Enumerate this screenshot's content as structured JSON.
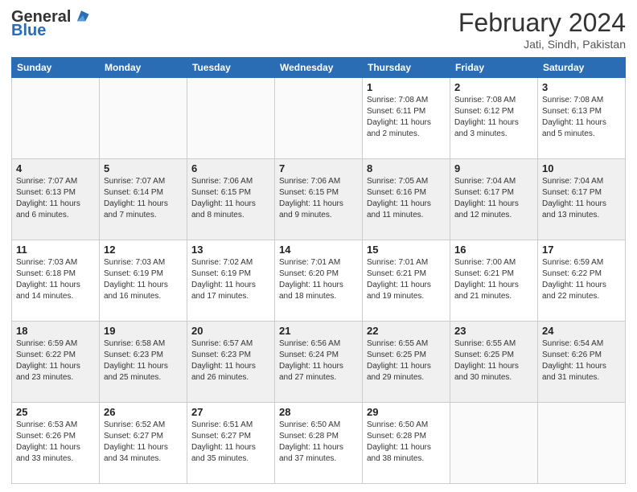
{
  "header": {
    "logo_general": "General",
    "logo_blue": "Blue",
    "month_title": "February 2024",
    "location": "Jati, Sindh, Pakistan"
  },
  "weekdays": [
    "Sunday",
    "Monday",
    "Tuesday",
    "Wednesday",
    "Thursday",
    "Friday",
    "Saturday"
  ],
  "weeks": [
    [
      {
        "day": "",
        "info": ""
      },
      {
        "day": "",
        "info": ""
      },
      {
        "day": "",
        "info": ""
      },
      {
        "day": "",
        "info": ""
      },
      {
        "day": "1",
        "info": "Sunrise: 7:08 AM\nSunset: 6:11 PM\nDaylight: 11 hours\nand 2 minutes."
      },
      {
        "day": "2",
        "info": "Sunrise: 7:08 AM\nSunset: 6:12 PM\nDaylight: 11 hours\nand 3 minutes."
      },
      {
        "day": "3",
        "info": "Sunrise: 7:08 AM\nSunset: 6:13 PM\nDaylight: 11 hours\nand 5 minutes."
      }
    ],
    [
      {
        "day": "4",
        "info": "Sunrise: 7:07 AM\nSunset: 6:13 PM\nDaylight: 11 hours\nand 6 minutes."
      },
      {
        "day": "5",
        "info": "Sunrise: 7:07 AM\nSunset: 6:14 PM\nDaylight: 11 hours\nand 7 minutes."
      },
      {
        "day": "6",
        "info": "Sunrise: 7:06 AM\nSunset: 6:15 PM\nDaylight: 11 hours\nand 8 minutes."
      },
      {
        "day": "7",
        "info": "Sunrise: 7:06 AM\nSunset: 6:15 PM\nDaylight: 11 hours\nand 9 minutes."
      },
      {
        "day": "8",
        "info": "Sunrise: 7:05 AM\nSunset: 6:16 PM\nDaylight: 11 hours\nand 11 minutes."
      },
      {
        "day": "9",
        "info": "Sunrise: 7:04 AM\nSunset: 6:17 PM\nDaylight: 11 hours\nand 12 minutes."
      },
      {
        "day": "10",
        "info": "Sunrise: 7:04 AM\nSunset: 6:17 PM\nDaylight: 11 hours\nand 13 minutes."
      }
    ],
    [
      {
        "day": "11",
        "info": "Sunrise: 7:03 AM\nSunset: 6:18 PM\nDaylight: 11 hours\nand 14 minutes."
      },
      {
        "day": "12",
        "info": "Sunrise: 7:03 AM\nSunset: 6:19 PM\nDaylight: 11 hours\nand 16 minutes."
      },
      {
        "day": "13",
        "info": "Sunrise: 7:02 AM\nSunset: 6:19 PM\nDaylight: 11 hours\nand 17 minutes."
      },
      {
        "day": "14",
        "info": "Sunrise: 7:01 AM\nSunset: 6:20 PM\nDaylight: 11 hours\nand 18 minutes."
      },
      {
        "day": "15",
        "info": "Sunrise: 7:01 AM\nSunset: 6:21 PM\nDaylight: 11 hours\nand 19 minutes."
      },
      {
        "day": "16",
        "info": "Sunrise: 7:00 AM\nSunset: 6:21 PM\nDaylight: 11 hours\nand 21 minutes."
      },
      {
        "day": "17",
        "info": "Sunrise: 6:59 AM\nSunset: 6:22 PM\nDaylight: 11 hours\nand 22 minutes."
      }
    ],
    [
      {
        "day": "18",
        "info": "Sunrise: 6:59 AM\nSunset: 6:22 PM\nDaylight: 11 hours\nand 23 minutes."
      },
      {
        "day": "19",
        "info": "Sunrise: 6:58 AM\nSunset: 6:23 PM\nDaylight: 11 hours\nand 25 minutes."
      },
      {
        "day": "20",
        "info": "Sunrise: 6:57 AM\nSunset: 6:23 PM\nDaylight: 11 hours\nand 26 minutes."
      },
      {
        "day": "21",
        "info": "Sunrise: 6:56 AM\nSunset: 6:24 PM\nDaylight: 11 hours\nand 27 minutes."
      },
      {
        "day": "22",
        "info": "Sunrise: 6:55 AM\nSunset: 6:25 PM\nDaylight: 11 hours\nand 29 minutes."
      },
      {
        "day": "23",
        "info": "Sunrise: 6:55 AM\nSunset: 6:25 PM\nDaylight: 11 hours\nand 30 minutes."
      },
      {
        "day": "24",
        "info": "Sunrise: 6:54 AM\nSunset: 6:26 PM\nDaylight: 11 hours\nand 31 minutes."
      }
    ],
    [
      {
        "day": "25",
        "info": "Sunrise: 6:53 AM\nSunset: 6:26 PM\nDaylight: 11 hours\nand 33 minutes."
      },
      {
        "day": "26",
        "info": "Sunrise: 6:52 AM\nSunset: 6:27 PM\nDaylight: 11 hours\nand 34 minutes."
      },
      {
        "day": "27",
        "info": "Sunrise: 6:51 AM\nSunset: 6:27 PM\nDaylight: 11 hours\nand 35 minutes."
      },
      {
        "day": "28",
        "info": "Sunrise: 6:50 AM\nSunset: 6:28 PM\nDaylight: 11 hours\nand 37 minutes."
      },
      {
        "day": "29",
        "info": "Sunrise: 6:50 AM\nSunset: 6:28 PM\nDaylight: 11 hours\nand 38 minutes."
      },
      {
        "day": "",
        "info": ""
      },
      {
        "day": "",
        "info": ""
      }
    ]
  ]
}
